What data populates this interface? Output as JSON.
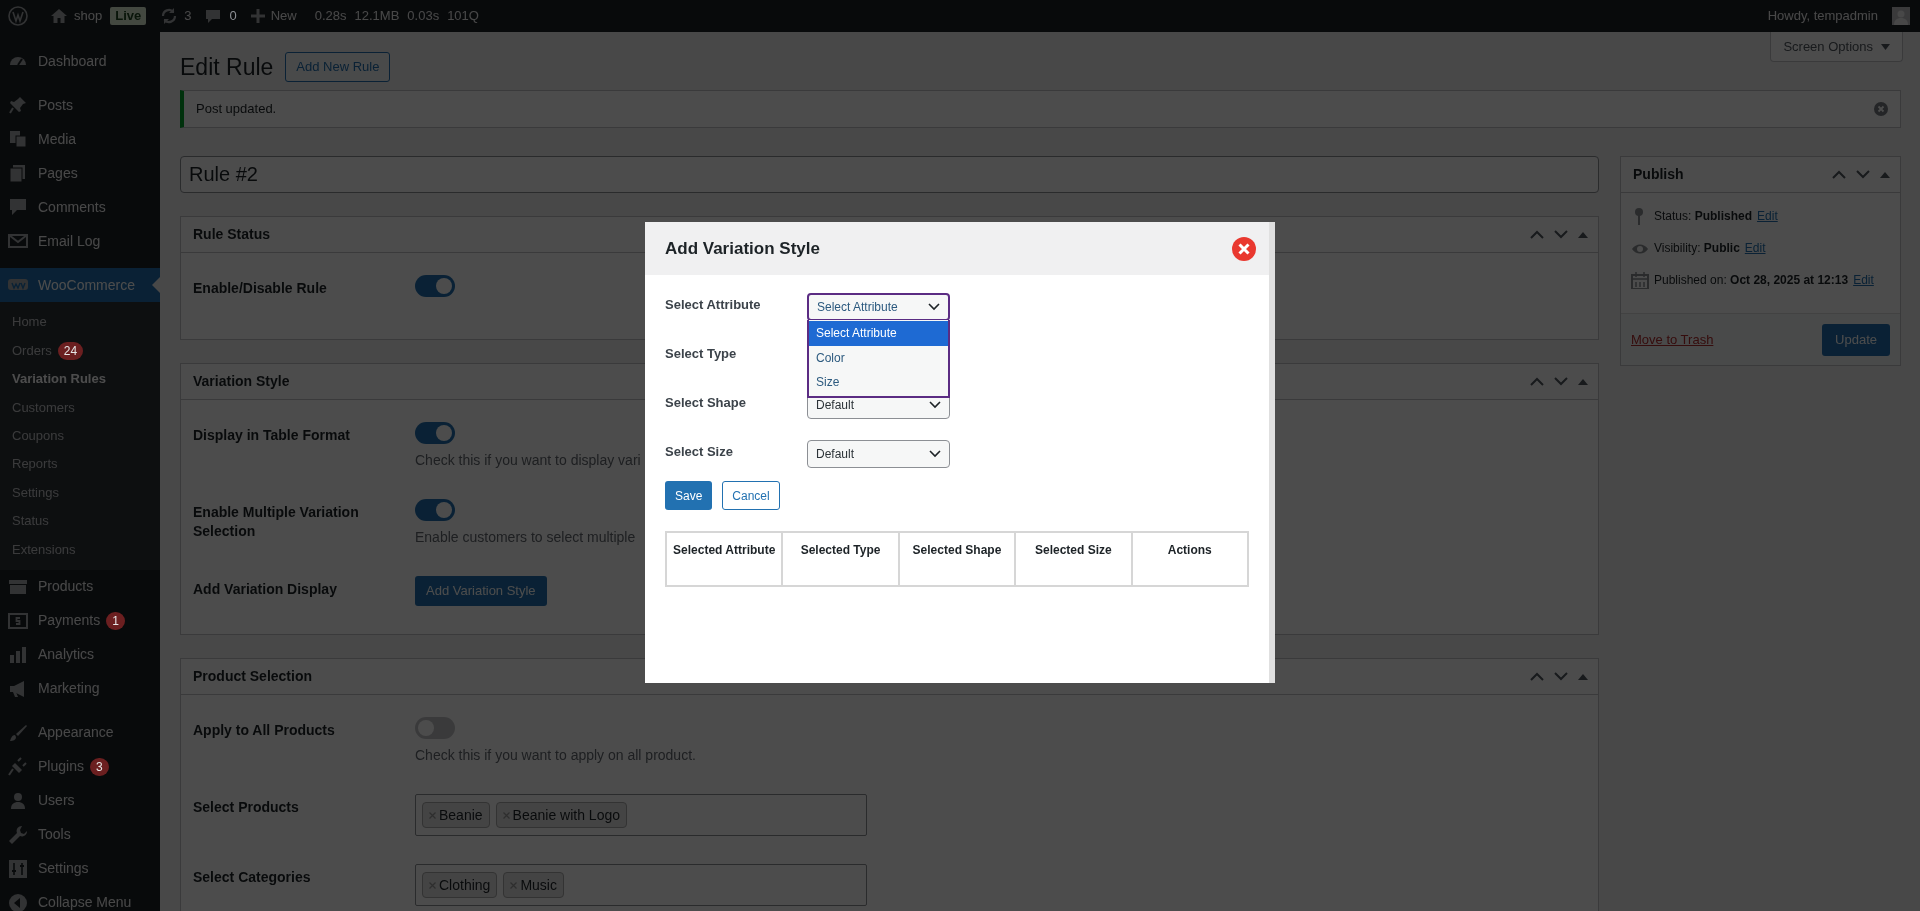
{
  "admin_bar": {
    "site": "shop",
    "live_badge": "Live",
    "updates": "3",
    "comments": "0",
    "new": "New",
    "stats": [
      "0.28s",
      "12.1MB",
      "0.03s",
      "101Q"
    ],
    "greeting": "Howdy, tempadmin"
  },
  "sidebar": {
    "groups": [
      [
        {
          "label": "Dashboard",
          "selected": false
        }
      ],
      [
        {
          "label": "Posts",
          "selected": false
        },
        {
          "label": "Media",
          "selected": false
        },
        {
          "label": "Pages",
          "selected": false
        },
        {
          "label": "Comments",
          "selected": false
        },
        {
          "label": "Email Log",
          "selected": false
        }
      ],
      [
        {
          "label": "WooCommerce",
          "selected": true,
          "children": [
            {
              "label": "Home",
              "selected": false
            },
            {
              "label": "Orders",
              "selected": false,
              "badge": "24"
            },
            {
              "label": "Variation Rules",
              "selected": true
            },
            {
              "label": "Customers",
              "selected": false
            },
            {
              "label": "Coupons",
              "selected": false
            },
            {
              "label": "Reports",
              "selected": false
            },
            {
              "label": "Settings",
              "selected": false
            },
            {
              "label": "Status",
              "selected": false
            },
            {
              "label": "Extensions",
              "selected": false
            }
          ]
        },
        {
          "label": "Products",
          "selected": false
        },
        {
          "label": "Payments",
          "selected": false,
          "badge": "1"
        },
        {
          "label": "Analytics",
          "selected": false
        },
        {
          "label": "Marketing",
          "selected": false
        }
      ],
      [
        {
          "label": "Appearance",
          "selected": false
        },
        {
          "label": "Plugins",
          "selected": false,
          "badge": "3"
        },
        {
          "label": "Users",
          "selected": false
        },
        {
          "label": "Tools",
          "selected": false
        },
        {
          "label": "Settings",
          "selected": false
        },
        {
          "label": "Collapse Menu",
          "selected": false
        }
      ]
    ]
  },
  "page": {
    "title": "Edit Rule",
    "add_new_button": "Add New Rule",
    "screen_options": "Screen Options",
    "notice": "Post updated.",
    "title_field": "Rule #2"
  },
  "panels": [
    {
      "title": "Rule Status",
      "rows": [
        {
          "kind": "toggle",
          "label": "Enable/Disable Rule",
          "on": true
        }
      ]
    },
    {
      "title": "Variation Style",
      "rows": [
        {
          "kind": "toggle",
          "label": "Display in Table Format",
          "on": true,
          "description": "Check this if you want to display vari"
        },
        {
          "kind": "toggle",
          "label": "Enable Multiple Variation Selection",
          "on": true,
          "description": "Enable customers to select multiple"
        },
        {
          "kind": "button",
          "label": "Add Variation Display",
          "button": "Add Variation Style"
        }
      ]
    },
    {
      "title": "Product Selection",
      "rows": [
        {
          "kind": "toggle",
          "label": "Apply to All Products",
          "on": false,
          "description": "Check this if you want to apply on all product."
        },
        {
          "kind": "tags",
          "label": "Select Products",
          "tags": [
            "Beanie",
            "Beanie with Logo"
          ]
        },
        {
          "kind": "tags",
          "label": "Select Categories",
          "tags": [
            "Clothing",
            "Music"
          ]
        }
      ]
    }
  ],
  "publish": {
    "title": "Publish",
    "rows": [
      {
        "text": "Status: **Published**",
        "link": "Edit"
      },
      {
        "text": "Visibility: **Public**",
        "link": "Edit"
      },
      {
        "text": "Published on: **Oct 28, 2025 at 12:13**",
        "link": "Edit"
      }
    ],
    "trash": "Move to Trash",
    "update": "Update"
  },
  "modal": {
    "title": "Add Variation Style",
    "fields": [
      {
        "label": "Select Attribute",
        "value": "Select Attribute",
        "open": true,
        "options": [
          {
            "label": "Select Attribute",
            "selected": true
          },
          {
            "label": "Color",
            "selected": false
          },
          {
            "label": "Size",
            "selected": false
          }
        ]
      },
      {
        "label": "Select Type"
      },
      {
        "label": "Select Shape",
        "value": "Default",
        "open": false
      },
      {
        "label": "Select Size",
        "value": "Default",
        "open": false
      }
    ],
    "save": "Save",
    "cancel": "Cancel",
    "table": {
      "columns": [
        "Selected Attribute",
        "Selected Type",
        "Selected Shape",
        "Selected Size",
        "Actions"
      ]
    }
  }
}
